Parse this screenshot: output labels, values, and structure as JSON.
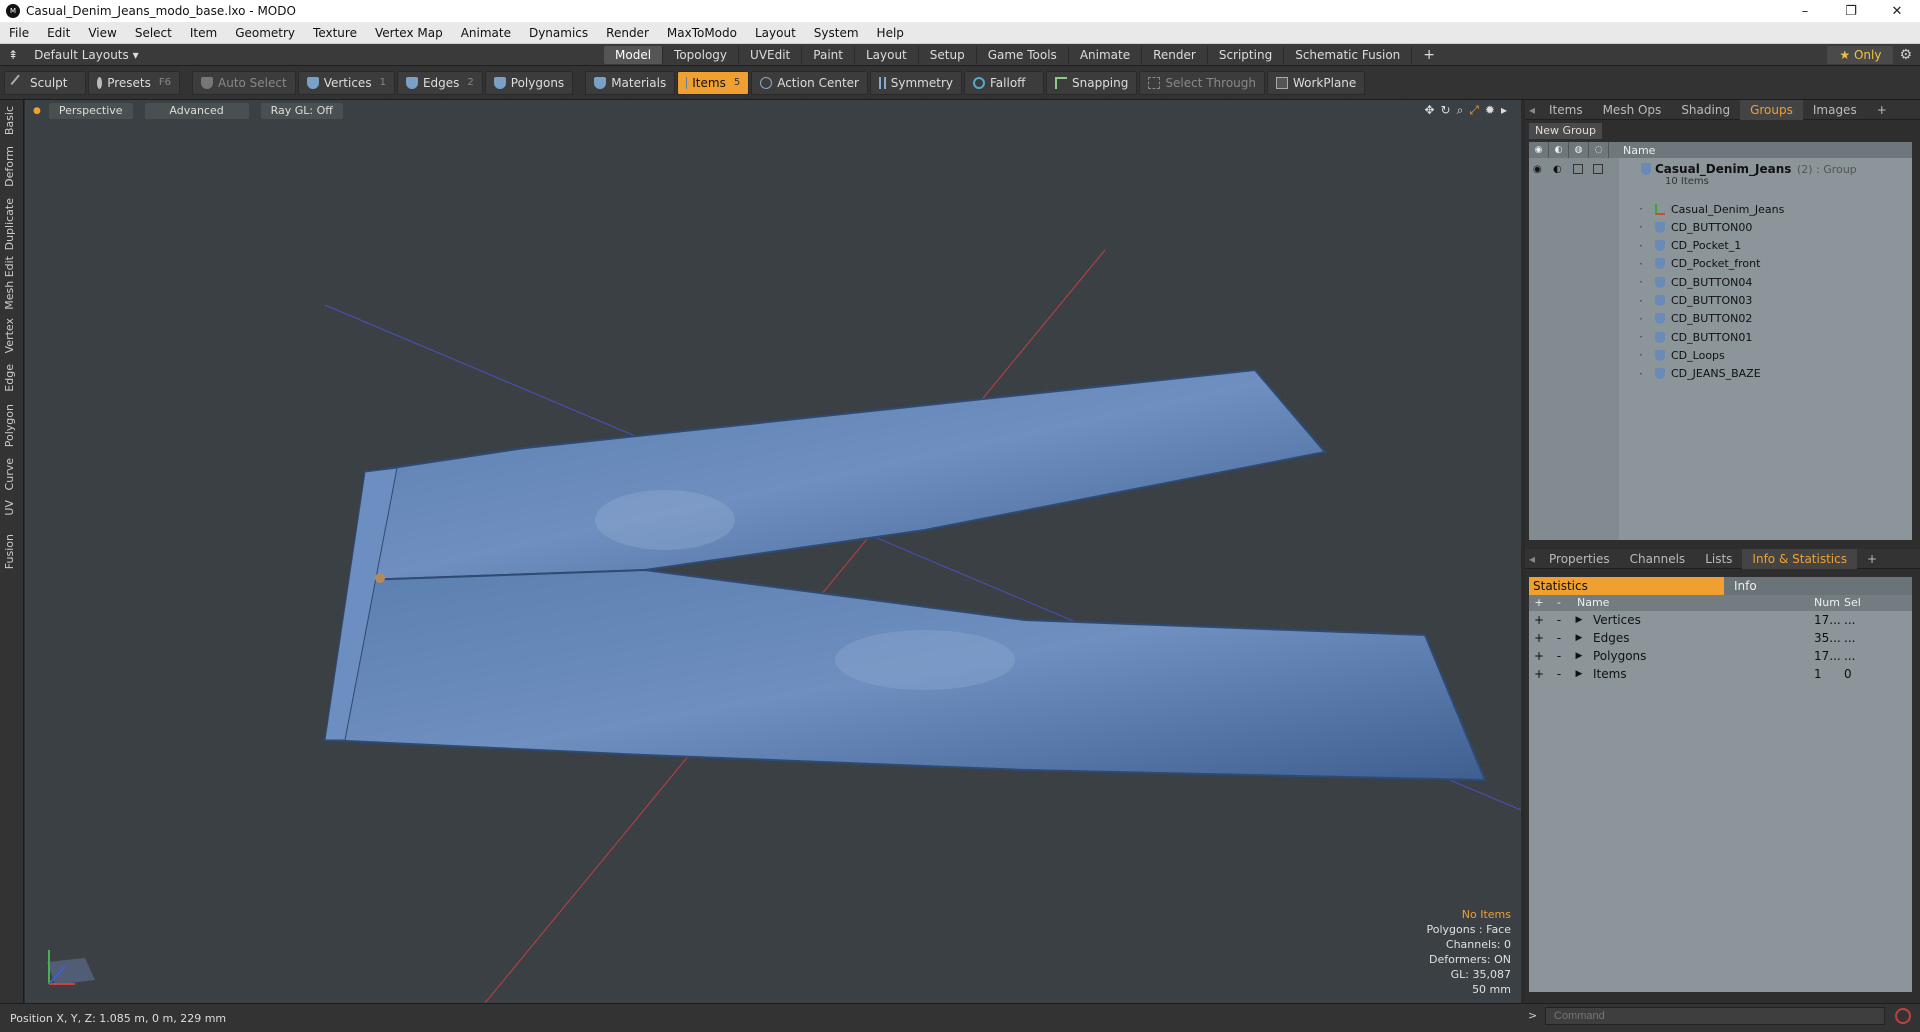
{
  "window": {
    "title": "Casual_Denim_Jeans_modo_base.lxo - MODO",
    "minimize": "–",
    "maximize": "❐",
    "close": "✕"
  },
  "menu": [
    "File",
    "Edit",
    "View",
    "Select",
    "Item",
    "Geometry",
    "Texture",
    "Vertex Map",
    "Animate",
    "Dynamics",
    "Render",
    "MaxToModo",
    "Layout",
    "System",
    "Help"
  ],
  "layoutbar": {
    "layouts_label": "Default Layouts ▾",
    "tabs": [
      "Model",
      "Topology",
      "UVEdit",
      "Paint",
      "Layout",
      "Setup",
      "Game Tools",
      "Animate",
      "Render",
      "Scripting",
      "Schematic Fusion",
      "+"
    ],
    "active_tab": "Model",
    "only": "★  Only"
  },
  "toolbar": {
    "sculpt": "Sculpt",
    "presets": "Presets",
    "presets_key": "F6",
    "auto_select": "Auto Select",
    "vertices": "Vertices",
    "vertices_key": "1",
    "edges": "Edges",
    "edges_key": "2",
    "polygons": "Polygons",
    "materials": "Materials",
    "items": "Items",
    "items_key": "5",
    "action_center": "Action Center",
    "symmetry": "Symmetry",
    "falloff": "Falloff",
    "snapping": "Snapping",
    "select_through": "Select Through",
    "workplane": "WorkPlane"
  },
  "lefttabs": [
    "Basic",
    "Deform",
    "Duplicate",
    "Mesh Edit",
    "Vertex",
    "Edge",
    "Polygon",
    "Curve",
    "UV",
    "Fusion"
  ],
  "viewport": {
    "perspective": "Perspective",
    "advanced": "Advanced",
    "raygl": "Ray GL: Off",
    "info": {
      "no_items": "No Items",
      "polygons": "Polygons : Face",
      "channels": "Channels: 0",
      "deformers": "Deformers: ON",
      "gl": "GL: 35,087",
      "mm": "50 mm"
    }
  },
  "groups_panel": {
    "tabs": [
      "Items",
      "Mesh Ops",
      "Shading",
      "Groups",
      "Images",
      "+"
    ],
    "active": "Groups",
    "new_group": "New Group",
    "name_col": "Name",
    "group_name": "Casual_Denim_Jeans",
    "group_suffix": "(2) : Group",
    "group_count": "10 Items",
    "items": [
      "Casual_Denim_Jeans",
      "CD_BUTTON00",
      "CD_Pocket_1",
      "CD_Pocket_front",
      "CD_BUTTON04",
      "CD_BUTTON03",
      "CD_BUTTON02",
      "CD_BUTTON01",
      "CD_Loops",
      "CD_JEANS_BAZE"
    ]
  },
  "stats_panel": {
    "tabs": [
      "Properties",
      "Channels",
      "Lists",
      "Info & Statistics",
      "+"
    ],
    "active": "Info & Statistics",
    "statistics": "Statistics",
    "info": "Info",
    "cols": {
      "name": "Name",
      "num": "Num",
      "sel": "Sel"
    },
    "rows": [
      {
        "name": "Vertices",
        "num": "17...",
        "sel": "..."
      },
      {
        "name": "Edges",
        "num": "35...",
        "sel": "..."
      },
      {
        "name": "Polygons",
        "num": "17...",
        "sel": "..."
      },
      {
        "name": "Items",
        "num": "1",
        "sel": "0"
      }
    ]
  },
  "status": {
    "position": "Position X, Y, Z:   1.085 m, 0 m, 229 mm",
    "command_placeholder": "Command",
    "prompt": ">"
  }
}
